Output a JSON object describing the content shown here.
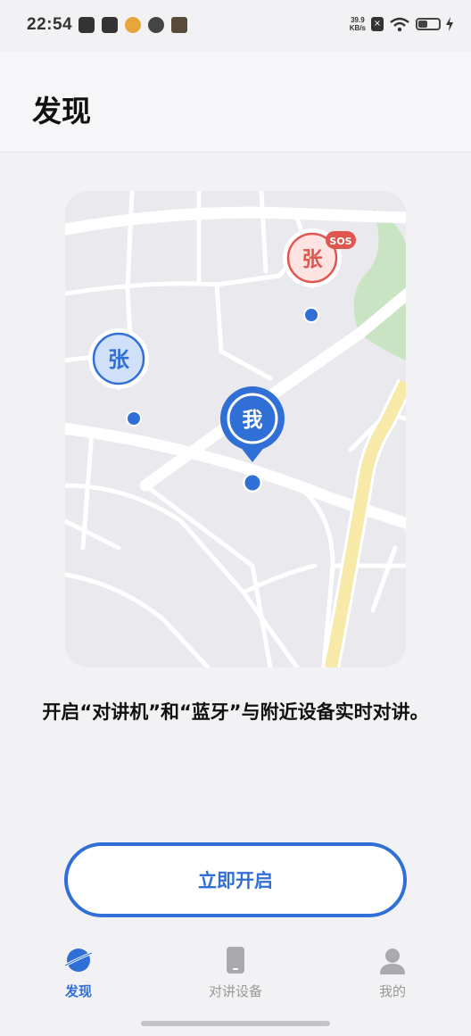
{
  "status_bar": {
    "time": "22:54",
    "net_speed_value": "39.9",
    "net_speed_unit": "KB/s",
    "battery_level": 0.45
  },
  "header": {
    "title": "发现"
  },
  "map": {
    "markers": [
      {
        "label": "张",
        "type": "contact",
        "alert": ""
      },
      {
        "label": "张",
        "type": "contact-sos",
        "alert": "SOS"
      },
      {
        "label": "我",
        "type": "self",
        "alert": ""
      }
    ]
  },
  "description": "开启“对讲机”和“蓝牙”与附近设备实时对讲。",
  "enable_button": {
    "label": "立即开启"
  },
  "tab_bar": {
    "tabs": [
      {
        "label": "发现",
        "icon": "planet-icon",
        "active": true
      },
      {
        "label": "对讲设备",
        "icon": "device-icon",
        "active": false
      },
      {
        "label": "我的",
        "icon": "person-icon",
        "active": false
      }
    ]
  },
  "colors": {
    "accent": "#2f6fd6",
    "sos_red": "#e0564f",
    "park_green": "#c9e4c2",
    "road_yellow": "#f7e9a8",
    "map_bg": "#e9e9ee"
  }
}
